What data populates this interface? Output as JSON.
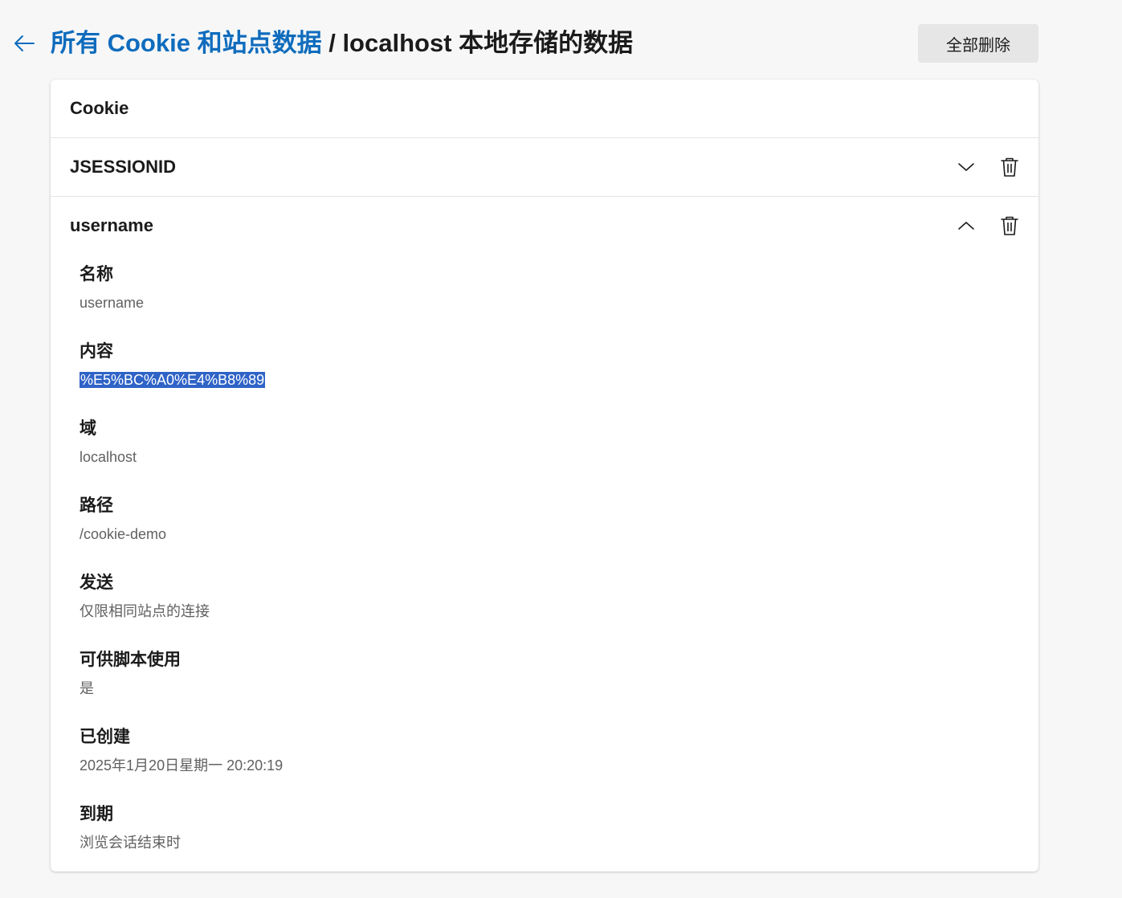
{
  "header": {
    "breadcrumb_link": "所有 Cookie 和站点数据",
    "separator": " / ",
    "current": "localhost 本地存储的数据",
    "delete_all_label": "全部删除"
  },
  "card": {
    "section_title": "Cookie",
    "cookies": [
      {
        "name": "JSESSIONID",
        "expanded": false
      },
      {
        "name": "username",
        "expanded": true
      }
    ],
    "details": [
      {
        "label": "名称",
        "value": "username"
      },
      {
        "label": "内容",
        "value": "%E5%BC%A0%E4%B8%89",
        "selected": true
      },
      {
        "label": "域",
        "value": "localhost"
      },
      {
        "label": "路径",
        "value": "/cookie-demo"
      },
      {
        "label": "发送",
        "value": "仅限相同站点的连接"
      },
      {
        "label": "可供脚本使用",
        "value": "是"
      },
      {
        "label": "已创建",
        "value": "2025年1月20日星期一 20:20:19"
      },
      {
        "label": "到期",
        "value": "浏览会话结束时"
      }
    ]
  },
  "icons": {
    "back": "arrow-left-icon",
    "expand": "chevron-down-icon",
    "collapse": "chevron-up-icon",
    "delete": "trash-icon"
  },
  "colors": {
    "accent": "#0f6cbd",
    "selection": "#2f63c7",
    "background": "#f7f7f7"
  }
}
